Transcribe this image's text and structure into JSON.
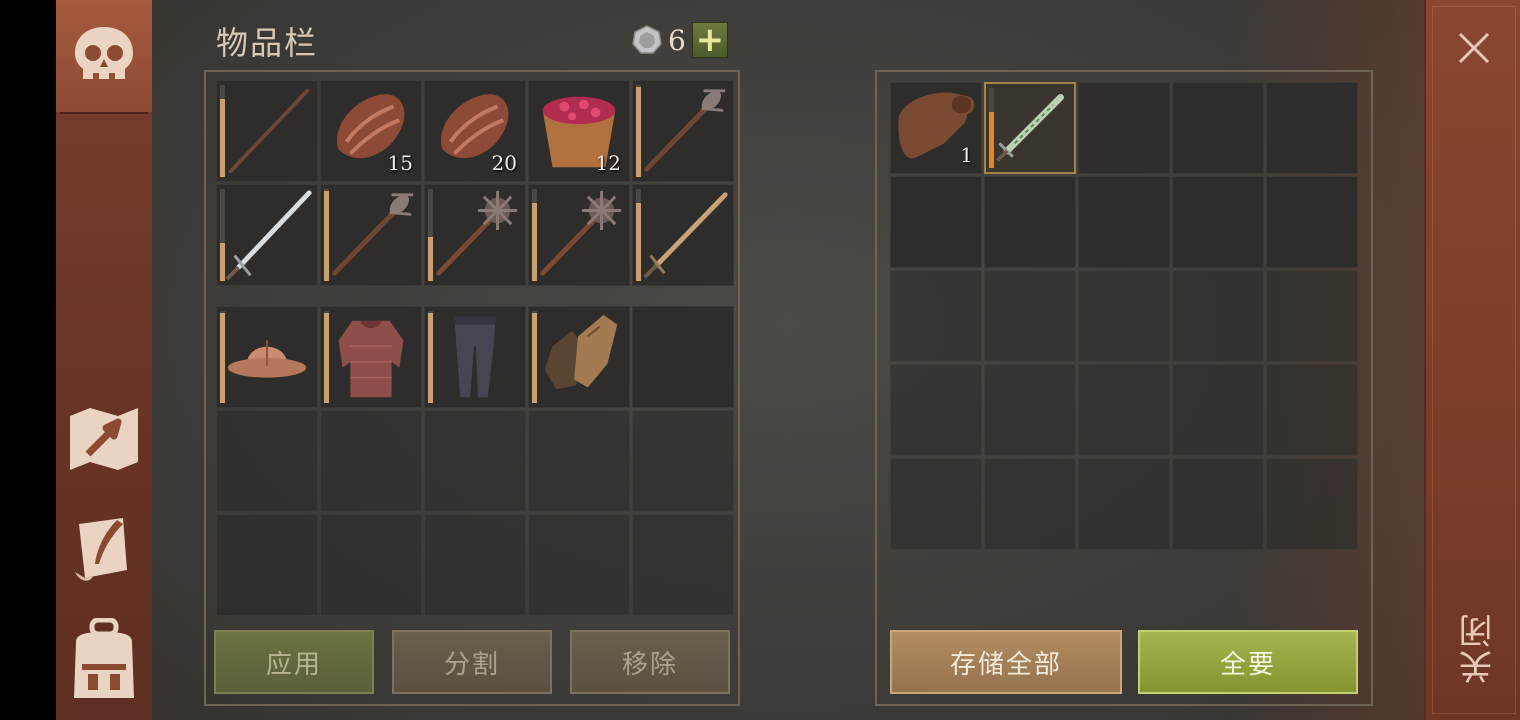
{
  "title": "物品栏",
  "currency": {
    "icon": "silver-coin-icon",
    "count": "6",
    "add_label": "+"
  },
  "sidebar": {
    "tabs": [
      {
        "name": "skull-icon",
        "active": true
      },
      {
        "name": "crafting-map-icon",
        "active": false
      },
      {
        "name": "scroll-quill-icon",
        "active": false
      },
      {
        "name": "backpack-icon",
        "active": false
      }
    ]
  },
  "inventory": {
    "row1": [
      {
        "item": "staff-icon",
        "qty": "",
        "durability": 0.8
      },
      {
        "item": "raw-meat-icon",
        "qty": "15"
      },
      {
        "item": "raw-meat-icon",
        "qty": "20"
      },
      {
        "item": "berry-bucket-icon",
        "qty": "12"
      },
      {
        "item": "spiked-mace-icon",
        "qty": "",
        "durability": 0.92
      }
    ],
    "row2": [
      {
        "item": "longsword-icon",
        "qty": "",
        "durability": 0.4
      },
      {
        "item": "spiked-mace-icon",
        "qty": "",
        "durability": 0.92
      },
      {
        "item": "morning-star-icon",
        "qty": "",
        "durability": 0.45
      },
      {
        "item": "morning-star-icon",
        "qty": "",
        "durability": 0.78
      },
      {
        "item": "bronze-sword-icon",
        "qty": "",
        "durability": 0.78
      }
    ],
    "equipment": [
      {
        "item": "kettle-helmet-icon",
        "durability": 0.92
      },
      {
        "item": "chainmail-armor-icon",
        "durability": 0.92
      },
      {
        "item": "leg-armor-icon",
        "durability": 0.92
      },
      {
        "item": "leather-gloves-icon",
        "durability": 0.92
      },
      {
        "item": "",
        "durability": null
      }
    ]
  },
  "storage": {
    "items": [
      {
        "item": "leather-roll-icon",
        "qty": "1",
        "selected": false
      },
      {
        "item": "jade-dagger-icon",
        "qty": "",
        "selected": true,
        "durability": 0.7
      }
    ]
  },
  "buttons": {
    "apply": "应用",
    "split": "分割",
    "remove": "移除",
    "store_all": "存储全部",
    "take_all": "全要"
  },
  "close": {
    "label": "关闭"
  },
  "colors": {
    "sidebar": "#6b3526",
    "accent_green": "#a8b450",
    "accent_tan": "#b38d62",
    "durability": "#c9a272",
    "durability_selected": "#e8871f"
  }
}
